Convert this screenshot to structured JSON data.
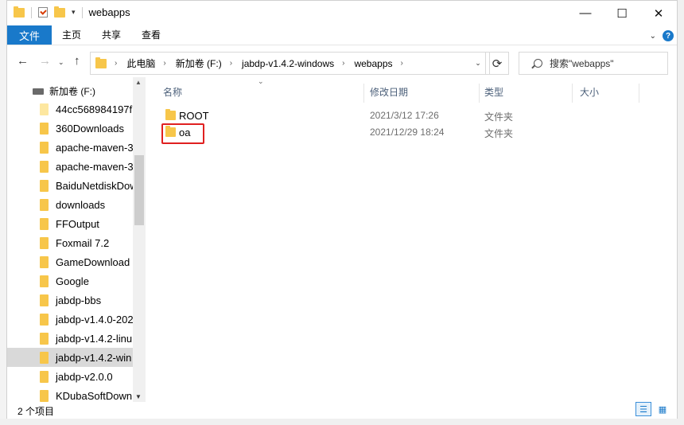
{
  "window": {
    "title": "webapps",
    "buttons": {
      "minimize": "—",
      "maximize": "☐",
      "close": "✕"
    }
  },
  "ribbon": {
    "file_tab": "文件",
    "tabs": [
      "主页",
      "共享",
      "查看"
    ]
  },
  "address": {
    "crumbs": [
      "此电脑",
      "新加卷 (F:)",
      "jabdp-v1.4.2-windows",
      "webapps"
    ],
    "search_placeholder": "搜索\"webapps\""
  },
  "nav_pane": {
    "drive_label": "新加卷 (F:)",
    "items": [
      {
        "label": "44cc568984197f7"
      },
      {
        "label": "360Downloads"
      },
      {
        "label": "apache-maven-3"
      },
      {
        "label": "apache-maven-3"
      },
      {
        "label": "BaiduNetdiskDow"
      },
      {
        "label": "downloads"
      },
      {
        "label": "FFOutput"
      },
      {
        "label": "Foxmail 7.2"
      },
      {
        "label": "GameDownload"
      },
      {
        "label": "Google"
      },
      {
        "label": "jabdp-bbs"
      },
      {
        "label": "jabdp-v1.4.0-202"
      },
      {
        "label": "jabdp-v1.4.2-linu"
      },
      {
        "label": "jabdp-v1.4.2-win"
      },
      {
        "label": "jabdp-v2.0.0"
      },
      {
        "label": "KDubaSoftDown"
      }
    ]
  },
  "columns": {
    "name": "名称",
    "date": "修改日期",
    "type": "类型",
    "size": "大小"
  },
  "files": [
    {
      "name": "ROOT",
      "date": "2021/3/12 17:26",
      "type": "文件夹"
    },
    {
      "name": "oa",
      "date": "2021/12/29 18:24",
      "type": "文件夹"
    }
  ],
  "status": {
    "item_count": "2 个项目"
  },
  "colors": {
    "accent": "#1979ca",
    "folder": "#f7c64a",
    "highlight_box": "#e02020"
  }
}
